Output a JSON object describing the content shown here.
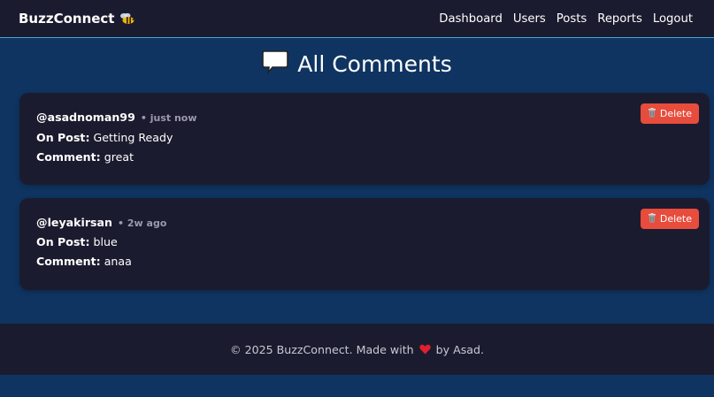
{
  "navbar": {
    "brand": "BuzzConnect",
    "brand_icon": "bee-icon",
    "links": [
      "Dashboard",
      "Users",
      "Posts",
      "Reports",
      "Logout"
    ]
  },
  "page": {
    "title": "All Comments",
    "title_icon": "speech-bubble-icon"
  },
  "comments": [
    {
      "username": "@asadnoman99",
      "time": "• just now",
      "post_label": "On Post:",
      "post": "Getting Ready",
      "comment_label": "Comment:",
      "comment": "great",
      "delete_label": "Delete"
    },
    {
      "username": "@leyakirsan",
      "time": "• 2w ago",
      "post_label": "On Post:",
      "post": "blue",
      "comment_label": "Comment:",
      "comment": "anaa",
      "delete_label": "Delete"
    }
  ],
  "footer": {
    "prefix": "© 2025 BuzzConnect. Made with",
    "suffix": "by Asad.",
    "heart_icon": "heart-icon"
  },
  "colors": {
    "background": "#0f3461",
    "panel": "#1b1b2f",
    "accent_border": "#3fa9d8",
    "danger": "#e74c3c"
  }
}
